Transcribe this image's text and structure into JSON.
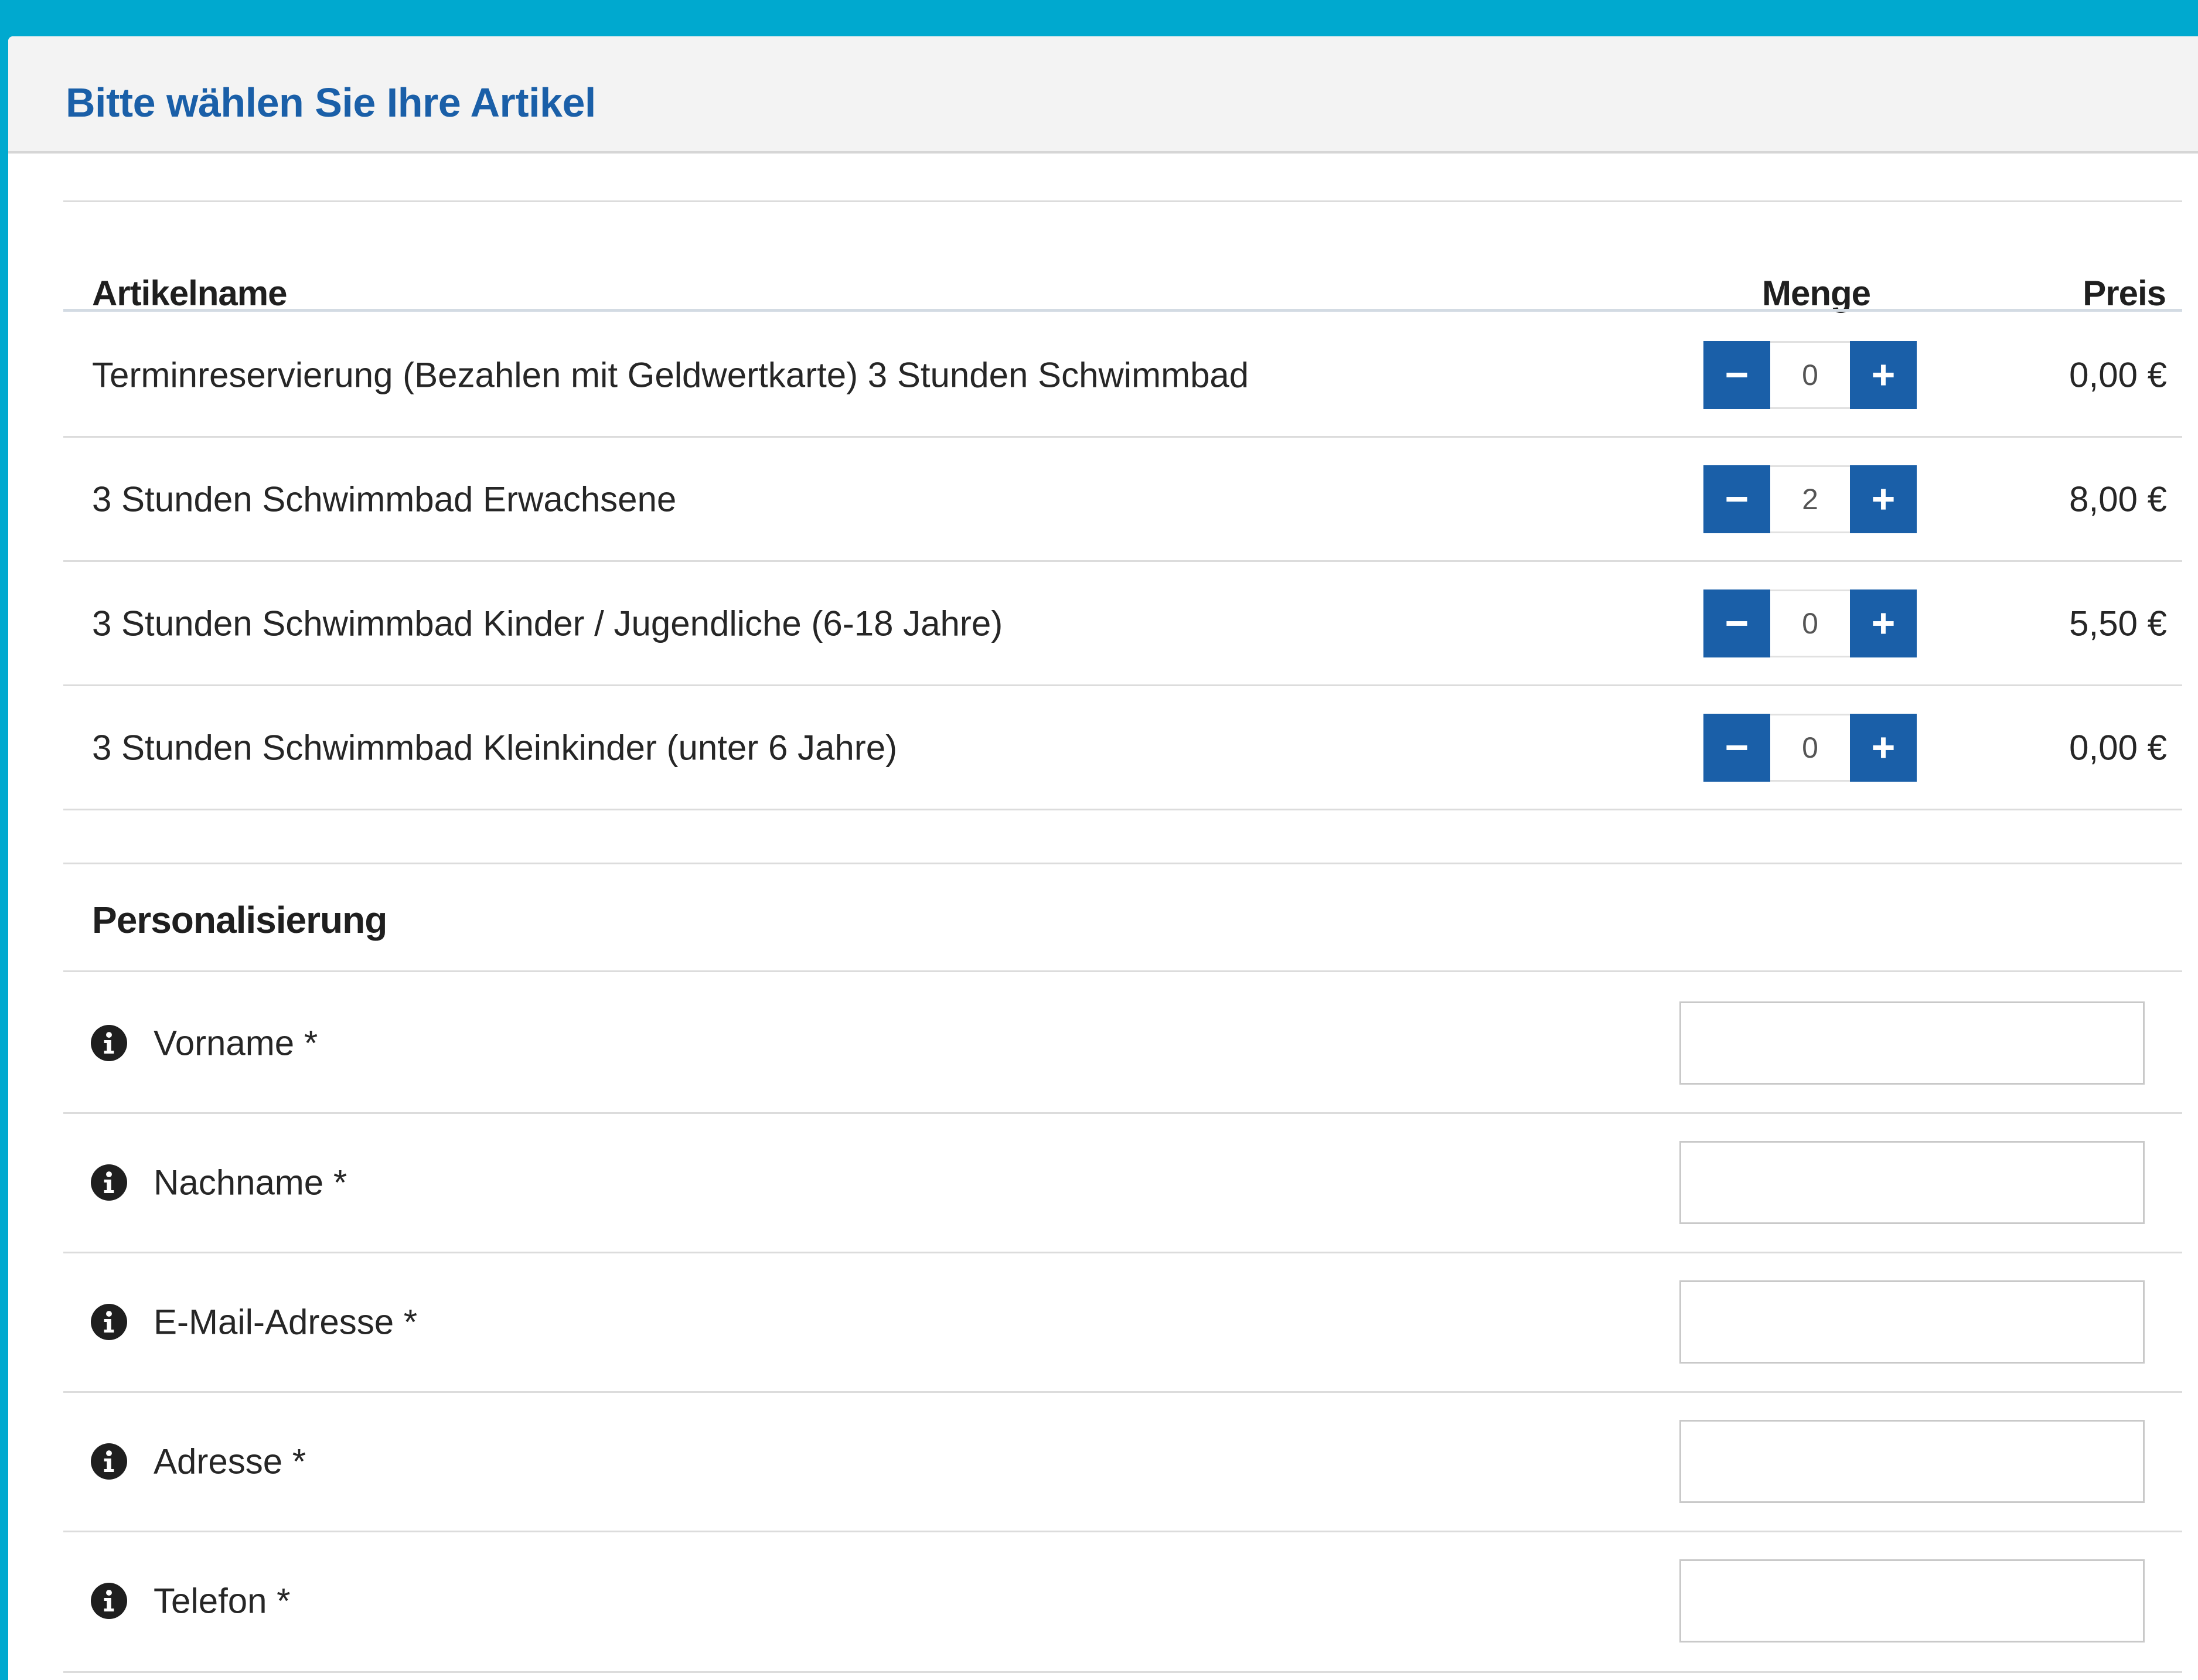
{
  "header": {
    "title": "Bitte wählen Sie Ihre Artikel"
  },
  "table": {
    "columns": {
      "name": "Artikelname",
      "quantity": "Menge",
      "price": "Preis"
    },
    "items": [
      {
        "name": "Terminreservierung (Bezahlen mit Geldwertkarte) 3 Stunden Schwimmbad",
        "quantity": "0",
        "price": "0,00 €"
      },
      {
        "name": "3 Stunden Schwimmbad Erwachsene",
        "quantity": "2",
        "price": "8,00 €"
      },
      {
        "name": "3 Stunden Schwimmbad Kinder / Jugendliche (6-18 Jahre)",
        "quantity": "0",
        "price": "5,50 €"
      },
      {
        "name": "3 Stunden Schwimmbad Kleinkinder (unter 6 Jahre)",
        "quantity": "0",
        "price": "0,00 €"
      }
    ],
    "stepper_icons": {
      "decrement": "minus-icon",
      "increment": "plus-icon"
    }
  },
  "personalization": {
    "title": "Personalisierung",
    "field_icon": "info-circle-icon",
    "fields": [
      {
        "label": "Vorname *",
        "value": ""
      },
      {
        "label": "Nachname *",
        "value": ""
      },
      {
        "label": "E-Mail-Adresse *",
        "value": ""
      },
      {
        "label": "Adresse *",
        "value": ""
      },
      {
        "label": "Telefon *",
        "value": ""
      }
    ]
  },
  "colors": {
    "page_background": "#00a9cf",
    "accent": "#1a5fa8",
    "header_background": "#f3f3f3"
  }
}
